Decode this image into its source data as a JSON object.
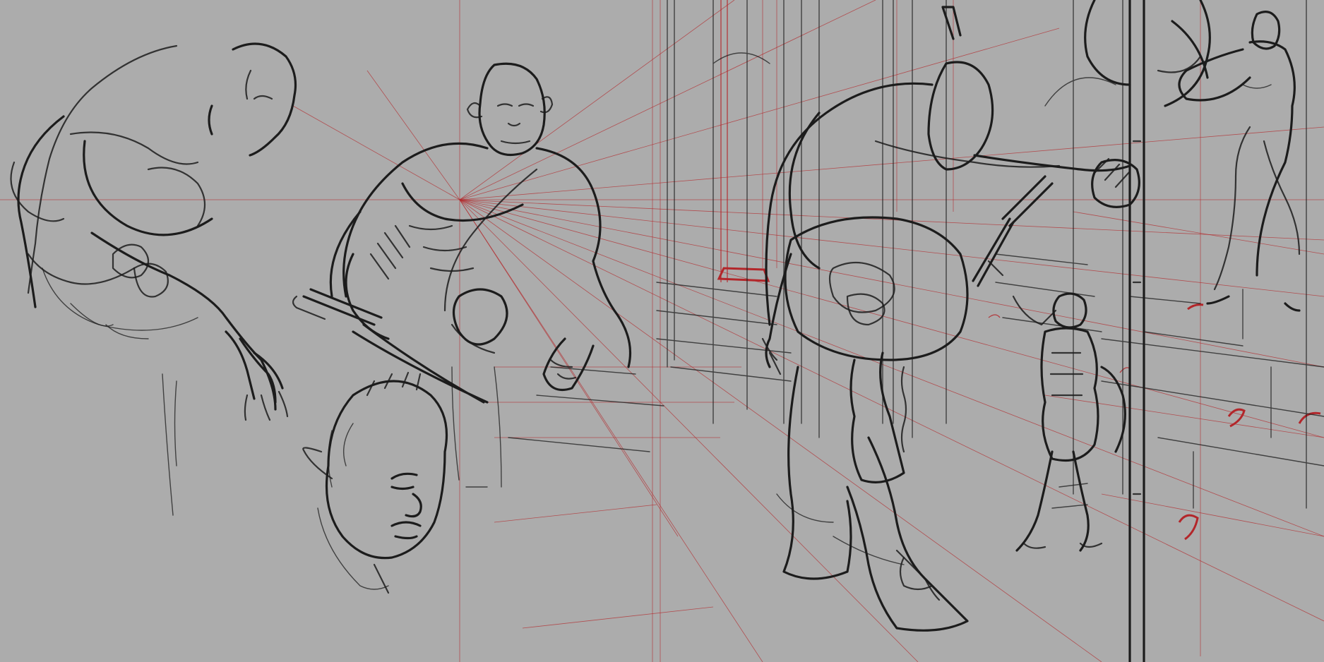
{
  "canvas": {
    "background": "#acacac",
    "ink_color": "#1c1c1c",
    "perspective_color": "#b3262a"
  },
  "figures": [
    {
      "id": "orc-hunched-study",
      "icon": "figure-sketch"
    },
    {
      "id": "orc-front-study",
      "icon": "figure-sketch"
    },
    {
      "id": "orc-head-study",
      "icon": "portrait-sketch"
    },
    {
      "id": "giant-orc-scene",
      "icon": "figure-sketch"
    },
    {
      "id": "armored-warrior",
      "icon": "figure-sketch"
    },
    {
      "id": "standing-woman",
      "icon": "figure-sketch"
    },
    {
      "id": "battle-axe",
      "icon": "weapon-sketch"
    }
  ]
}
